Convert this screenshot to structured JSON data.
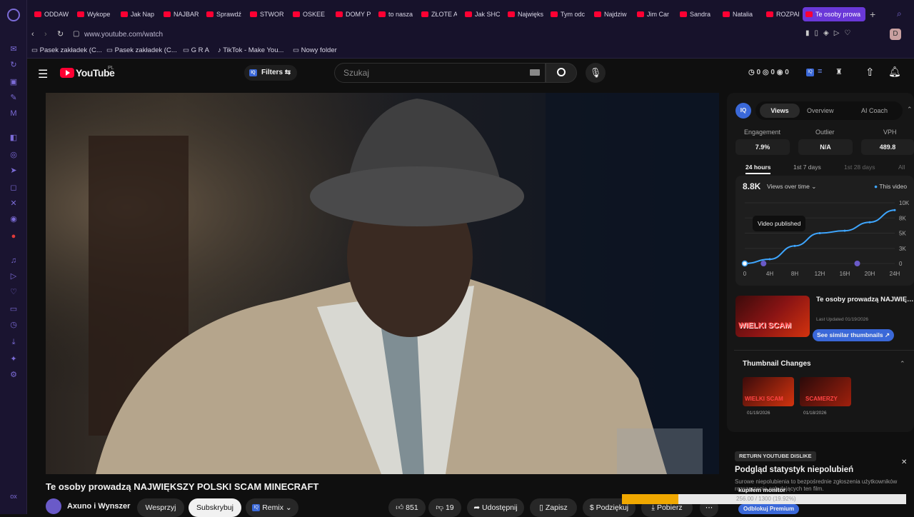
{
  "browser": {
    "tabs": [
      "ODDAW",
      "Wykope",
      "Jak Nap",
      "NAJBAR",
      "Sprawdź",
      "STWOR",
      "OSKEE",
      "DOMY P",
      "to nasza",
      "ZŁOTE A",
      "Jak SHC",
      "Największ",
      "Tym odc",
      "Najdziw",
      "Jim Car",
      "Sandra",
      "Natalia",
      "ROZPAD",
      "Te osoby prowa"
    ],
    "active_tab": "Te osoby prowa",
    "url": "www.youtube.com/watch",
    "profile_initial": "D",
    "bookmarks": [
      "Pasek zakładek (C...",
      "Pasek zakładek (C...",
      "G R A",
      "TikTok - Make You...",
      "Nowy folder"
    ]
  },
  "youtube": {
    "logo": "YouTube",
    "region": "PL",
    "filters_label": "Filters",
    "search_placeholder": "Szukaj",
    "counters": [
      "0",
      "0",
      "0"
    ]
  },
  "video": {
    "title": "Te osoby prowadzą NAJWIĘKSZY POLSKI SCAM MINECRAFT",
    "channel": "Axuno i Wynszer",
    "support_label": "Wesprzyj",
    "subscribe_label": "Subskrybuj",
    "remix_label": "Remix",
    "likes": "851",
    "dislikes": "19",
    "share_label": "Udostępnij",
    "save_label": "Zapisz",
    "thanks_label": "Podziękuj",
    "download_label": "Pobierz",
    "download_progress": "256.00 / 1300 (19.92%)",
    "download_fraction": 0.1992
  },
  "panel": {
    "badge": "IQ",
    "tabs": [
      "Views",
      "Overview",
      "AI Coach"
    ],
    "active_tab": "Views",
    "stats": [
      {
        "label": "Engagement",
        "value": "7.9%"
      },
      {
        "label": "Outlier",
        "value": "N/A"
      },
      {
        "label": "VPH",
        "value": "489.8"
      }
    ],
    "ranges": [
      "24 hours",
      "1st 7 days",
      "1st 28 days",
      "All"
    ],
    "active_range": "24 hours",
    "views_total": "8.8K",
    "views_dropdown": "Views over time",
    "legend": "This video",
    "tooltip": "Video published",
    "accent": "#3ea6ff"
  },
  "chart_data": {
    "type": "line",
    "x": [
      "0",
      "4H",
      "8H",
      "12H",
      "16H",
      "20H",
      "24H"
    ],
    "series": [
      {
        "values": [
          0,
          700,
          2900,
          5000,
          5400,
          6800,
          8800
        ]
      }
    ],
    "yticks": [
      "10K",
      "8K",
      "5K",
      "3K",
      "0"
    ],
    "ylim": [
      0,
      10000
    ]
  },
  "thumb_card": {
    "title": "Te osoby prowadzą NAJWIĘKSZY POLSKI SCAM...",
    "updated": "Last Updated 01/19/2026",
    "button": "See similar thumbnails",
    "thumb_text": "WIELKI SCAM"
  },
  "thumbnail_changes": {
    "heading": "Thumbnail Changes",
    "items": [
      {
        "text": "WIELKI SCAM",
        "date": "01/19/2026"
      },
      {
        "text": "SCAMERZY",
        "date": "01/18/2026"
      }
    ]
  },
  "dislike": {
    "tag": "RETURN YOUTUBE DISLIKE",
    "heading": "Podgląd statystyk niepolubień",
    "body": "Surowe niepolubienia to bezpośrednie zgłoszenia użytkowników rozszerzenia oglądających ten film.",
    "overlay": "kupiłem monitor",
    "unlock": "Odblokuj Premium"
  }
}
